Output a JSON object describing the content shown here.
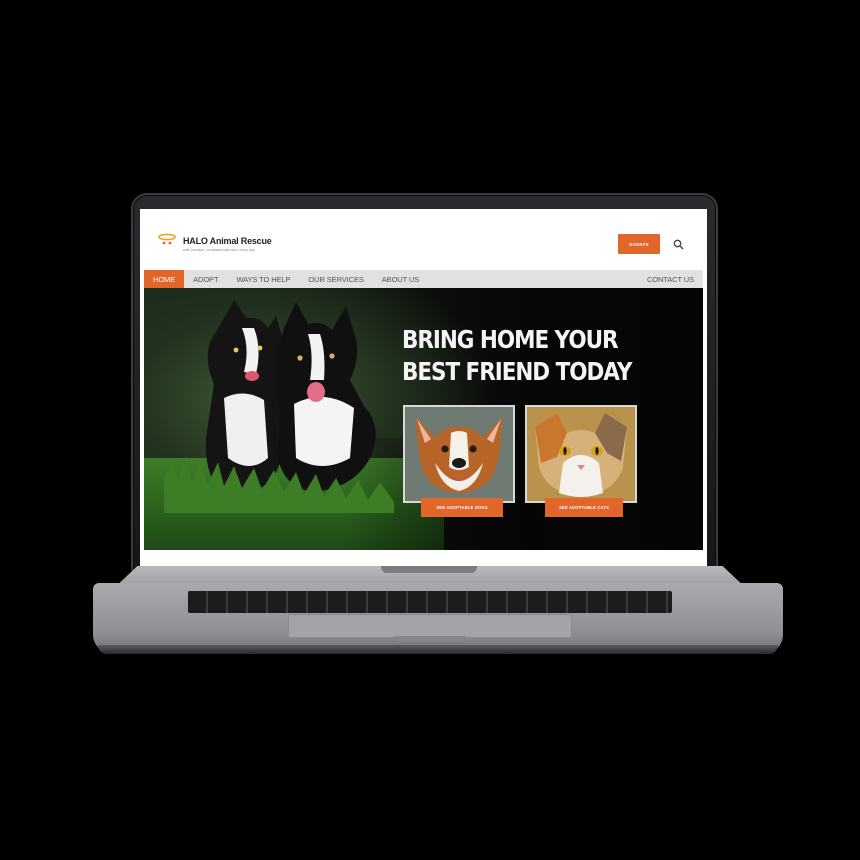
{
  "site": {
    "brand_name": "HALO Animal Rescue",
    "brand_tagline": "safe, humane, compassionate care, every day",
    "donate_label": "DONATE",
    "accent_color": "#e2662a",
    "icons": {
      "logo": "halo-logo-icon",
      "search": "search-icon"
    }
  },
  "nav": {
    "items": [
      {
        "label": "HOME",
        "active": true
      },
      {
        "label": "ADOPT",
        "active": false
      },
      {
        "label": "WAYS TO HELP",
        "active": false
      },
      {
        "label": "OUR SERVICES",
        "active": false
      },
      {
        "label": "ABOUT US",
        "active": false
      }
    ],
    "right_item": {
      "label": "CONTACT US"
    }
  },
  "hero": {
    "headline_line1": "BRING HOME YOUR",
    "headline_line2": "BEST FRIEND TODAY",
    "dogs_button": "SEE ADOPTABLE DOGS",
    "cats_button": "SEE ADOPTABLE CATS"
  }
}
